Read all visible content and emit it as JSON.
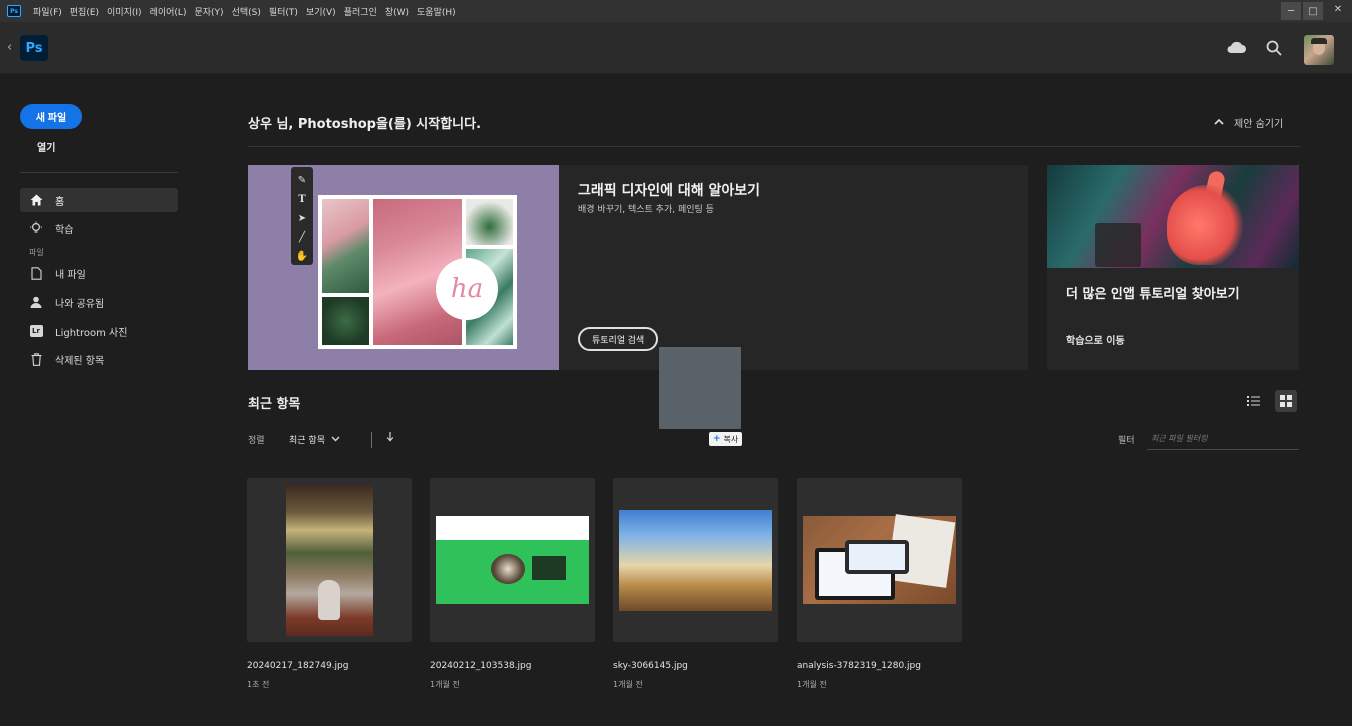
{
  "menubar": {
    "app_icon": "Ps",
    "items": [
      "파일(F)",
      "편집(E)",
      "이미지(I)",
      "레이어(L)",
      "문자(Y)",
      "선택(S)",
      "필터(T)",
      "보기(V)",
      "플러그인",
      "창(W)",
      "도움말(H)"
    ],
    "window_controls": [
      "─",
      "□",
      "✕"
    ]
  },
  "appbar": {
    "logo": "Ps",
    "icons": [
      "cloud-icon",
      "search-icon",
      "avatar"
    ]
  },
  "sidebar": {
    "new_file": "새 파일",
    "open": "열기",
    "items": [
      {
        "label": "홈",
        "icon": "home-icon",
        "active": true
      },
      {
        "label": "학습",
        "icon": "lightbulb-icon",
        "active": false
      }
    ],
    "section_label": "파일",
    "file_items": [
      {
        "label": "내 파일",
        "icon": "document-icon"
      },
      {
        "label": "나와 공유됨",
        "icon": "person-icon"
      },
      {
        "label": "Lightroom 사진",
        "icon": "lightroom-icon",
        "badge": "Lr"
      },
      {
        "label": "삭제된 항목",
        "icon": "trash-icon"
      }
    ]
  },
  "main": {
    "greeting": "상우 님, Photoshop을(를) 시작합니다.",
    "hide_suggestions": "제안 숨기기",
    "hero": {
      "title": "그래픽 디자인에 대해 알아보기",
      "subtitle": "배경 바꾸기, 텍스트 추가, 페인팅 등",
      "button": "튜토리얼 검색",
      "art_text": "ha"
    },
    "side_card": {
      "title": "더 많은 인앱 튜토리얼 찾아보기",
      "link": "학습으로 이동"
    },
    "recent": {
      "title": "최근 항목",
      "sort_label": "정렬",
      "sort_value": "최근 항목",
      "filter_label": "필터",
      "filter_placeholder": "최근 파일 필터링",
      "copy_tooltip": "복사",
      "files": [
        {
          "name": "20240217_182749.jpg",
          "time": "1초 전"
        },
        {
          "name": "20240212_103538.jpg",
          "time": "1개월 전"
        },
        {
          "name": "sky-3066145.jpg",
          "time": "1개월 전"
        },
        {
          "name": "analysis-3782319_1280.jpg",
          "time": "1개월 전"
        }
      ]
    }
  },
  "colors": {
    "accent": "#1473e6",
    "ps_blue": "#31a8ff",
    "background": "#1e1e1e",
    "panel": "#262626"
  }
}
